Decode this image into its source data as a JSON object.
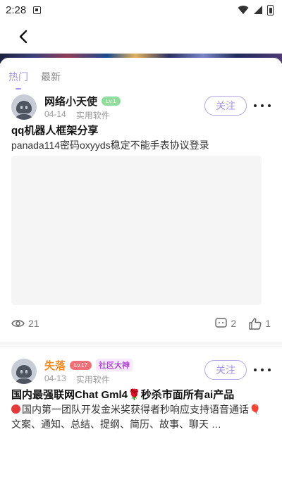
{
  "status_bar": {
    "time": "2:28"
  },
  "icons": {
    "back": "arrow-left-icon",
    "follow_more": "more-dots-icon",
    "views": "eye-icon",
    "comments": "comment-icon",
    "likes": "thumb-up-icon"
  },
  "colors": {
    "accent": "#a793e3",
    "orange_name": "#f08a24",
    "level_green": "#8fdc9d",
    "level_red": "#f07078"
  },
  "tabs": [
    {
      "label": "热门",
      "active": true
    },
    {
      "label": "最新",
      "active": false
    }
  ],
  "posts": [
    {
      "username": "网络小天使",
      "level": "Lv.1",
      "date": "04-14",
      "category": "实用软件",
      "follow_label": "关注",
      "title": "qq机器人框架分享",
      "text": "panada114密码oxyyds稳定不能手表协议登录",
      "views": "21",
      "comments": "2",
      "likes": "1"
    },
    {
      "username": "失落",
      "level": "Lv.17",
      "badge": "社区大神",
      "date": "04-13",
      "category": "实用软件",
      "follow_label": "关注",
      "title": "国内最强联网Chat Gml4🌹秒杀市面所有ai产品",
      "text": "国内第一团队开发金米奖获得者秒响应支持语音通话🎈文案、通知、总结、提纲、简历、故事、聊天 …"
    }
  ]
}
